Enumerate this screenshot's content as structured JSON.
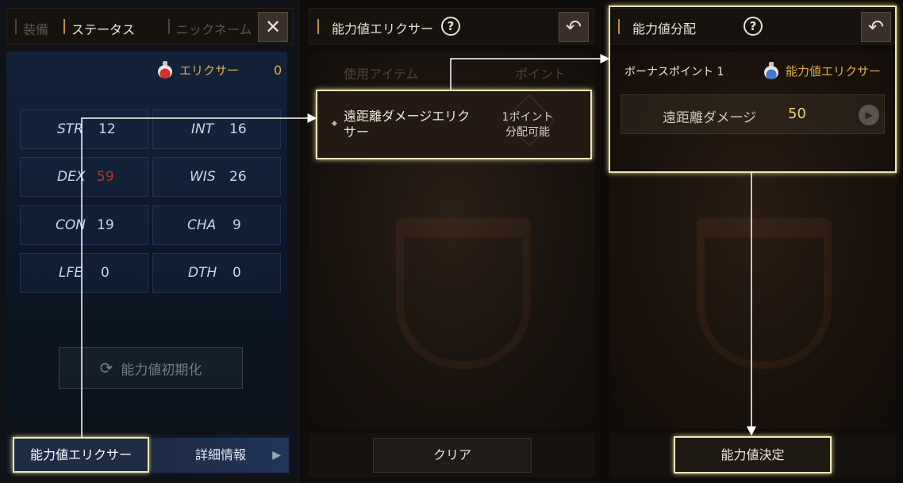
{
  "status_panel": {
    "tabs": [
      {
        "label": "装備"
      },
      {
        "label": "ステータス"
      },
      {
        "label": "ニックネーム"
      }
    ],
    "close_icon": "close-icon",
    "elixir": {
      "label": "エリクサー",
      "count": "0",
      "icon": "red-potion-icon"
    },
    "stats": [
      {
        "name": "STR",
        "value": "12"
      },
      {
        "name": "INT",
        "value": "16"
      },
      {
        "name": "DEX",
        "value": "59",
        "color": "#c0342c"
      },
      {
        "name": "WIS",
        "value": "26"
      },
      {
        "name": "CON",
        "value": "19"
      },
      {
        "name": "CHA",
        "value": "9"
      },
      {
        "name": "LFE",
        "value": "0"
      },
      {
        "name": "DTH",
        "value": "0"
      }
    ],
    "reset_label": "能力値初期化",
    "elixir_button_label": "能力値エリクサー",
    "detail_button_label": "詳細情報"
  },
  "elixir_panel": {
    "title": "能力値エリクサー",
    "help_label": "?",
    "subtabs": [
      "使用アイテム",
      "ポイント"
    ],
    "item": {
      "name": "遠距離ダメージエリクサー",
      "points_line1": "1ポイント",
      "points_line2": "分配可能"
    },
    "clear_label": "クリア"
  },
  "distribution_panel": {
    "title": "能力値分配",
    "help_label": "?",
    "bonus_label": "ボーナスポイント 1",
    "elixir_label": "能力値エリクサー",
    "row": {
      "name": "遠距離ダメージ",
      "value": "50"
    },
    "decide_label": "能力値決定"
  },
  "colors": {
    "accent_gold": "#e3a84a",
    "highlight": "#f0e6b8",
    "stat_red": "#c0342c"
  }
}
